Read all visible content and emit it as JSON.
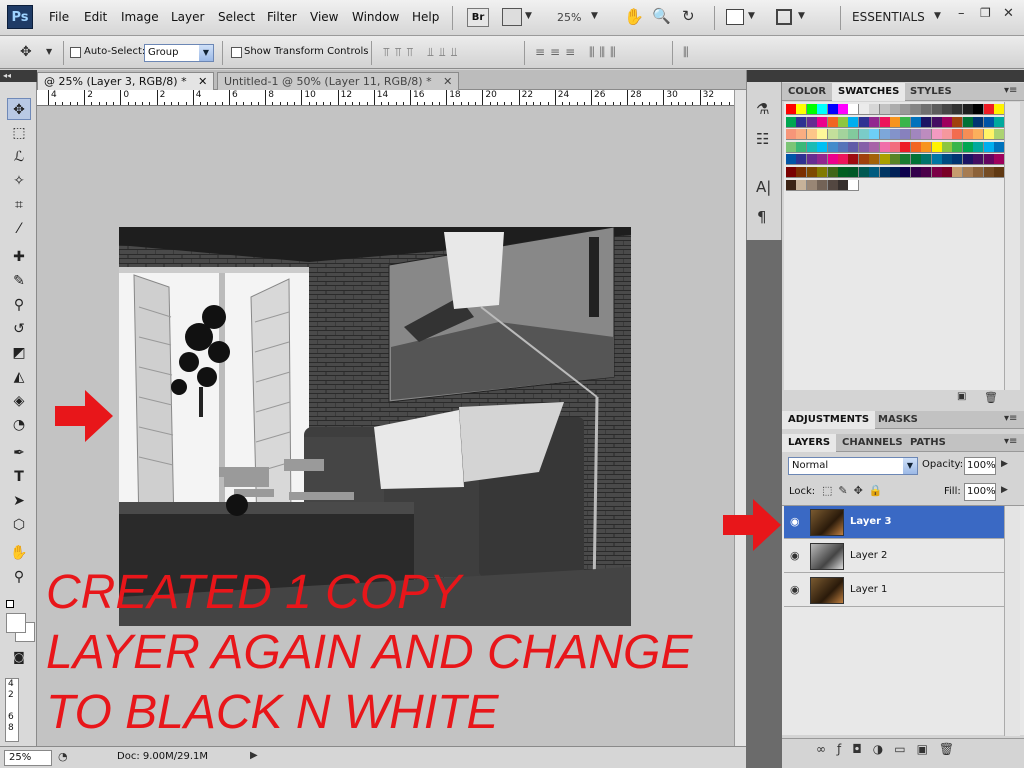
{
  "app": {
    "logo": "Ps"
  },
  "menu": [
    "File",
    "Edit",
    "Image",
    "Layer",
    "Select",
    "Filter",
    "View",
    "Window",
    "Help"
  ],
  "appbar": {
    "bridge_label": "Br",
    "zoom": "25%",
    "workspace": "ESSENTIALS"
  },
  "options": {
    "auto_select_label": "Auto-Select:",
    "auto_select_value": "Group",
    "show_transform_label": "Show Transform Controls"
  },
  "doctabs": [
    {
      "label": "@ 25% (Layer 3, RGB/8) *",
      "active": true
    },
    {
      "label": "Untitled-1 @ 50% (Layer 11, RGB/8) *",
      "active": false
    }
  ],
  "ruler_labels": [
    "4",
    "2",
    "0",
    "2",
    "4",
    "6",
    "8",
    "10",
    "12",
    "14",
    "16",
    "18",
    "20",
    "22",
    "24",
    "26",
    "28",
    "30",
    "32"
  ],
  "status": {
    "zoom": "25%",
    "doc": "Doc: 9.00M/29.1M"
  },
  "annotation": {
    "line1": "CREATED 1 COPY",
    "line2": "LAYER AGAIN AND CHANGE",
    "line3": "TO BLACK N WHITE"
  },
  "panels": {
    "color_tabs": [
      "COLOR",
      "SWATCHES",
      "STYLES"
    ],
    "adjust_tabs": [
      "ADJUSTMENTS",
      "MASKS"
    ],
    "layer_tabs": [
      "LAYERS",
      "CHANNELS",
      "PATHS"
    ],
    "blend_mode": "Normal",
    "opacity_label": "Opacity:",
    "opacity_value": "100%",
    "lock_label": "Lock:",
    "fill_label": "Fill:",
    "fill_value": "100%"
  },
  "layers": [
    {
      "name": "Layer 3",
      "selected": true
    },
    {
      "name": "Layer 2",
      "selected": false
    },
    {
      "name": "Layer 1",
      "selected": false
    }
  ],
  "colors": {
    "accent": "#3a69c4",
    "annotation": "#e8161a"
  }
}
